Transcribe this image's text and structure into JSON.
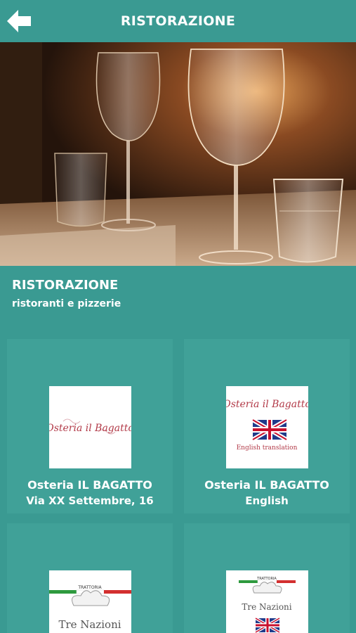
{
  "header": {
    "title": "RISTORAZIONE",
    "back_icon": "arrow-left-icon"
  },
  "intro": {
    "title": "RISTORAZIONE",
    "subtitle": "ristoranti e pizzerie"
  },
  "cards": [
    {
      "name": "Osteria IL BAGATTO",
      "detail": "Via XX Settembre, 16",
      "logo_text": "Osteria il Bagatto"
    },
    {
      "name": "Osteria IL BAGATTO",
      "detail": "English",
      "logo_text": "Osteria il Bagatto",
      "logo_caption": "English translation"
    },
    {
      "name": "",
      "detail": "",
      "logo_label": "TRATTORIA",
      "logo_text": "Tre Nazioni"
    },
    {
      "name": "",
      "detail": "",
      "logo_label": "TRATTORIA",
      "logo_text": "Tre Nazioni"
    }
  ],
  "colors": {
    "primary": "#3a9a92",
    "card": "#40a198",
    "logo_red": "#b23a48"
  }
}
